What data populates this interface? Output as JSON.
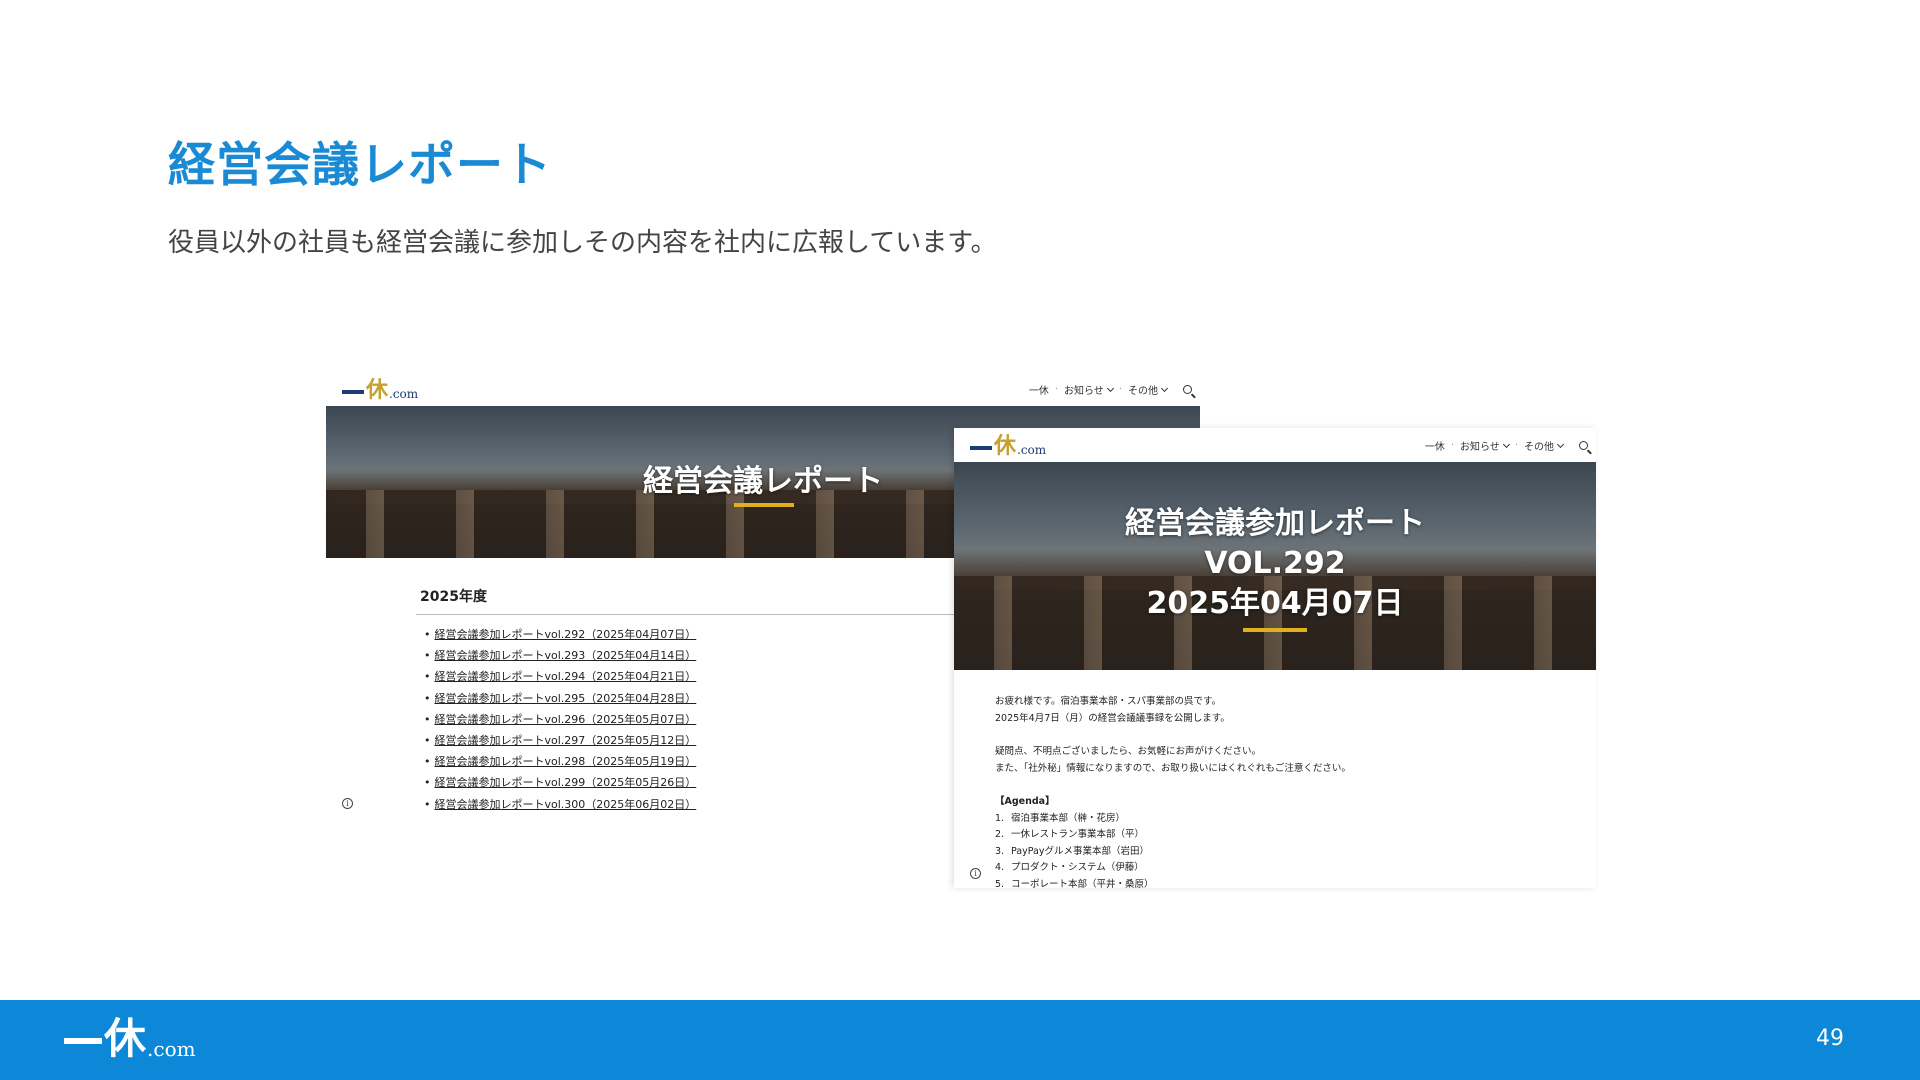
{
  "slide": {
    "title": "経営会議レポート",
    "subtitle": "役員以外の社員も経営会議に参加しその内容を社内に広報しています。",
    "page_number": "49"
  },
  "site": {
    "logo_kanji": "休",
    "logo_com": ".com",
    "nav": {
      "item1": "一休",
      "item2": "お知らせ",
      "item3": "その他"
    }
  },
  "list_page": {
    "hero_title": "経営会議レポート",
    "year_heading": "2025年度",
    "reports": [
      "経営会議参加レポートvol.292（2025年04月07日）",
      "経営会議参加レポートvol.293（2025年04月14日）",
      "経営会議参加レポートvol.294（2025年04月21日）",
      "経営会議参加レポートvol.295（2025年04月28日）",
      "経営会議参加レポートvol.296（2025年05月07日）",
      "経営会議参加レポートvol.297（2025年05月12日）",
      "経営会議参加レポートvol.298（2025年05月19日）",
      "経営会議参加レポートvol.299（2025年05月26日）",
      "経営会議参加レポートvol.300（2025年06月02日）"
    ]
  },
  "detail_page": {
    "hero_line1": "経営会議参加レポート",
    "hero_line2": "VOL.292",
    "hero_line3": "2025年04月07日",
    "para1_line1": "お疲れ様です。宿泊事業本部・スパ事業部の呉です。",
    "para1_line2": "2025年4月7日（月）の経営会議議事録を公開します。",
    "para2_line1": "疑問点、不明点ございましたら、お気軽にお声がけください。",
    "para2_line2": "また、「社外秘」情報になりますので、お取り扱いにはくれぐれもご注意ください。",
    "agenda_title": "【Agenda】",
    "agenda": [
      {
        "num": "1.",
        "text": "宿泊事業本部（榊・花房）"
      },
      {
        "num": "2.",
        "text": "一休レストラン事業本部（平）"
      },
      {
        "num": "3.",
        "text": "PayPayグルメ事業本部（岩田）"
      },
      {
        "num": "4.",
        "text": "プロダクト・システム（伊藤）"
      },
      {
        "num": "5.",
        "text": "コーポレート本部（平井・桑原）"
      }
    ]
  },
  "colors": {
    "accent": "#1a8ad4",
    "footer": "#0d87d7",
    "logo_navy": "#1c3d74",
    "logo_gold": "#c6a030",
    "hero_underline": "#e0b020"
  },
  "icons": {
    "search": "search-icon",
    "chevron": "chevron-down-icon",
    "info": "info-icon"
  }
}
